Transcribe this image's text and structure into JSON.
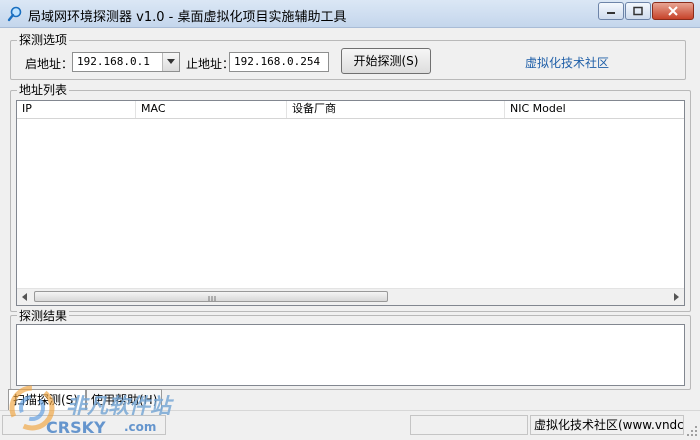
{
  "window": {
    "title": "局域网环境探测器 v1.0 - 桌面虚拟化项目实施辅助工具"
  },
  "options": {
    "group_label": "探测选项",
    "start_label": "启地址：",
    "start_value": "192.168.0.1",
    "end_label": "止地址：",
    "end_value": "192.168.0.254",
    "probe_button": "开始探测(S)",
    "community_link": "虚拟化技术社区"
  },
  "addresses": {
    "group_label": "地址列表",
    "columns": [
      "IP",
      "MAC",
      "设备厂商",
      "NIC Model"
    ],
    "rows": []
  },
  "result": {
    "group_label": "探测结果",
    "text": ""
  },
  "tabs": [
    "扫描探测(S)",
    "使用帮助(H)"
  ],
  "statusbar": {
    "panel_1": "",
    "panel_2": "",
    "panel_3": "虚拟化技术社区(www.vndc"
  },
  "watermark": {
    "line1": "非凡软件站",
    "line2": "CRSKY",
    "line3": ".com"
  }
}
